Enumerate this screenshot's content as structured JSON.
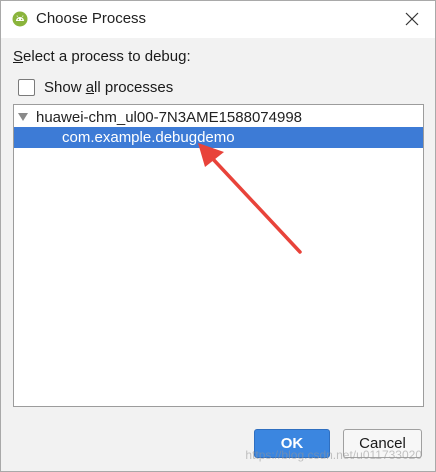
{
  "dialog": {
    "title": "Choose Process",
    "prompt": {
      "mnemonic": "S",
      "rest": "elect a process to debug:"
    },
    "show_all": {
      "label_before": "Show ",
      "mnemonic": "a",
      "label_after": "ll processes",
      "checked": false
    },
    "tree": {
      "device": "huawei-chm_ul00-7N3AME1588074998",
      "process": "com.example.debugdemo",
      "selected_color": "#3d7bd6"
    },
    "buttons": {
      "ok": "OK",
      "cancel": "Cancel"
    }
  },
  "watermark": "https://blog.csdn.net/u011733020",
  "colors": {
    "annotation_arrow": "#e8433a",
    "ok_button": "#3b86e0"
  },
  "icons": {
    "app": "android-icon",
    "close": "close-icon",
    "expand": "triangle-down-icon"
  }
}
